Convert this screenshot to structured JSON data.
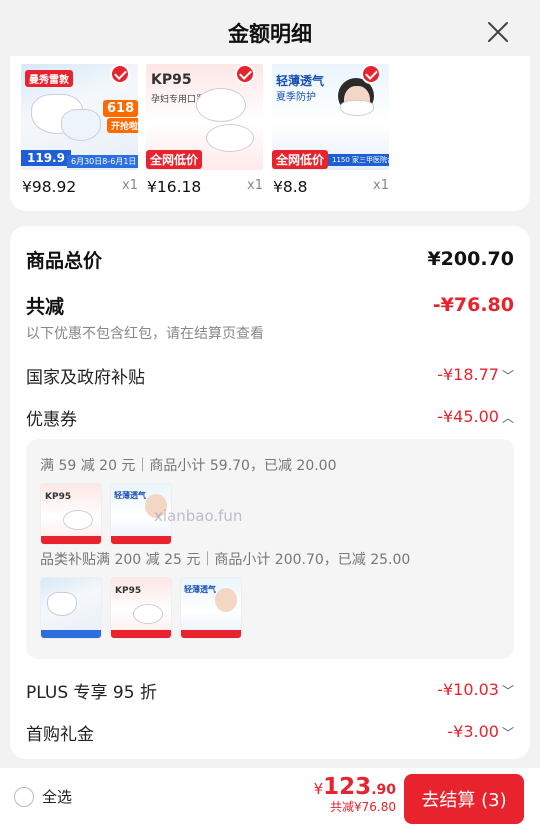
{
  "header": {
    "title": "金额明细"
  },
  "products": [
    {
      "price": "¥98.92",
      "qty": "x1",
      "brand": "曼秀雷敦",
      "badge": "618",
      "tag": "开抢啦",
      "sub": "6月30日8-6月1日",
      "pr": "119.9"
    },
    {
      "price": "¥16.18",
      "qty": "x1",
      "brand": "KP95",
      "line": "孕妇专用口罩",
      "badge": "全网低价"
    },
    {
      "price": "¥8.8",
      "qty": "x1",
      "headline": "轻薄透气",
      "line": "夏季防护",
      "badge": "全网低价",
      "tag": "1150 家三甲医院合作"
    }
  ],
  "summary": {
    "total_label": "商品总价",
    "total_value": "¥200.70",
    "discount_label": "共减",
    "discount_value": "-¥76.80",
    "note": "以下优惠不包含红包，请在结算页查看"
  },
  "items": [
    {
      "label": "国家及政府补贴",
      "value": "-¥18.77"
    },
    {
      "label": "优惠券",
      "value": "-¥45.00"
    },
    {
      "label": "PLUS 专享 95 折",
      "value": "-¥10.03"
    },
    {
      "label": "首购礼金",
      "value": "-¥3.00"
    }
  ],
  "coupons": [
    {
      "line": "满 59 减 20 元｜商品小计 59.70，已减 20.00"
    },
    {
      "line": "品类补贴满 200 减 25 元｜商品小计 200.70，已减 25.00"
    }
  ],
  "watermark": "xianbao.fun",
  "bottom": {
    "select_all": "全选",
    "currency": "¥",
    "total_int": "123",
    "total_dec": ".90",
    "saved": "共减¥76.80",
    "checkout": "去结算 (3)"
  },
  "colors": {
    "accent": "#e8232d"
  }
}
